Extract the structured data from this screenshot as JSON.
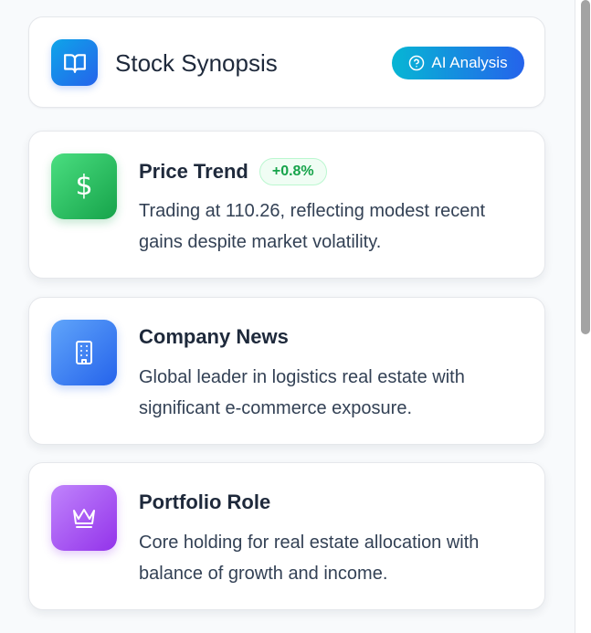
{
  "header": {
    "title": "Stock Synopsis",
    "icon": "book-open-icon",
    "ai_button_label": "AI Analysis",
    "ai_button_icon": "help-circle-icon"
  },
  "cards": [
    {
      "title": "Price Trend",
      "badge": "+0.8%",
      "text": "Trading at 110.26, reflecting modest recent gains despite market volatility.",
      "icon": "dollar-icon",
      "icon_color": "#22c55e"
    },
    {
      "title": "Company News",
      "text": "Global leader in logistics real estate with significant e-commerce exposure.",
      "icon": "building-icon",
      "icon_color": "#3b82f6"
    },
    {
      "title": "Portfolio Role",
      "text": "Core holding for real estate allocation with balance of growth and income.",
      "icon": "crown-icon",
      "icon_color": "#a855f7"
    }
  ],
  "colors": {
    "badge_text": "#16a34a",
    "accent": "#2563eb"
  }
}
